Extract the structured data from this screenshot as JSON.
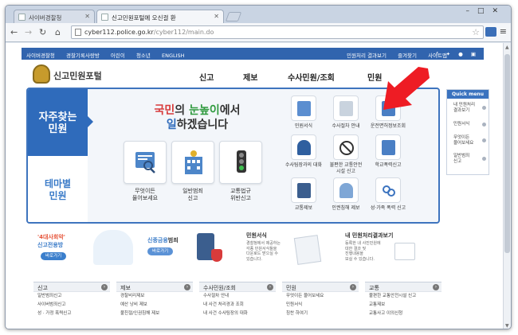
{
  "browser": {
    "tabs": [
      {
        "title": "사이버경찰청"
      },
      {
        "title": "신고민원포털에 오신걸 환"
      }
    ],
    "url_domain": "cyber112.police.go.kr",
    "url_path": "/cyber112/main.do"
  },
  "util_bar": {
    "left_links": [
      "사이버경찰청",
      "경찰기록사랑방",
      "어린이",
      "청소년",
      "ENGLISH"
    ],
    "right_links": [
      "민원처리 결과보기",
      "즐겨찾기",
      "사이트맵"
    ]
  },
  "header": {
    "logo_text": "신고민원포털",
    "gnb": [
      "신고",
      "제보",
      "수사민원/조회",
      "민원"
    ]
  },
  "main": {
    "faq_label_1": "자주찾는",
    "faq_label_2": "민원",
    "theme_label_1": "테마별",
    "theme_label_2": "민원",
    "headline_l1_a": "국민",
    "headline_l1_b": "의 ",
    "headline_l1_c": "눈높이",
    "headline_l1_d": "에서",
    "headline_l2_a": "일",
    "headline_l2_b": "하겠습니다",
    "tiles": [
      {
        "line1": "무엇이든",
        "line2": "물어보세요"
      },
      {
        "line1": "일반범죄",
        "line2": "신고"
      },
      {
        "line1": "교통법규",
        "line2": "위반신고"
      }
    ],
    "services": [
      {
        "line1": "민원서식",
        "line2": ""
      },
      {
        "line1": "수사절차 안내",
        "line2": ""
      },
      {
        "line1": "운전면허정보조회",
        "line2": ""
      },
      {
        "line1": "수사팀장과의 대화",
        "line2": ""
      },
      {
        "line1": "불편한 교통안전",
        "line2": "시설 신고"
      },
      {
        "line1": "학교폭력신고",
        "line2": ""
      },
      {
        "line1": "교통제보",
        "line2": ""
      },
      {
        "line1": "인권침해 제보",
        "line2": ""
      },
      {
        "line1": "성·가족 폭력 신고",
        "line2": ""
      }
    ]
  },
  "quick_menu": {
    "title": "Quick menu",
    "items": [
      {
        "line1": "내 민원처리",
        "line2": "결과보기"
      },
      {
        "line1": "민원서식",
        "line2": ""
      },
      {
        "line1": "무엇이든",
        "line2": "물어보세요"
      },
      {
        "line1": "일반범죄",
        "line2": "신고"
      }
    ]
  },
  "banners": {
    "b1_title_1": "'4대사회악'",
    "b1_title_2": "신고전용방",
    "b1_button": "바로가기",
    "b2_title_a": "신종금융",
    "b2_title_b": "범죄",
    "b2_button": "바로가기",
    "b3_title": "민원서식",
    "b3_text": [
      "경찰청에서 제공하는",
      "각종 민원서식들을",
      "다운로드 받으실 수",
      "있습니다."
    ],
    "b4_title": "내 민원처리결과보기",
    "b4_text": [
      "등록한 내 사진민원에",
      "대한 결과 및",
      "진행내용을",
      "보실 수 있습니다."
    ]
  },
  "categories": [
    {
      "title": "신고",
      "items": [
        "일반범죄신고",
        "사이버범죄신고",
        "성 · 가정 폭력신고"
      ]
    },
    {
      "title": "제보",
      "items": [
        "경찰비리제보",
        "예산 낭비 제보",
        "불친절/인권침해 제보"
      ]
    },
    {
      "title": "수사민원/조회",
      "items": [
        "수사절차 안내",
        "내 사건 처리경과 조회",
        "내 사건 수사팀장의 대화"
      ]
    },
    {
      "title": "민원",
      "items": [
        "무엇이든 물어보세요",
        "민원서식",
        "칭찬 하여기"
      ]
    },
    {
      "title": "교통",
      "items": [
        "불편한 교통안전시설 신고",
        "교통제보",
        "교통사고 이의신청"
      ]
    }
  ],
  "colors": {
    "brand_blue": "#2f6bbb",
    "util_bar": "#3164ae",
    "arrow_red": "#ee1c24"
  }
}
